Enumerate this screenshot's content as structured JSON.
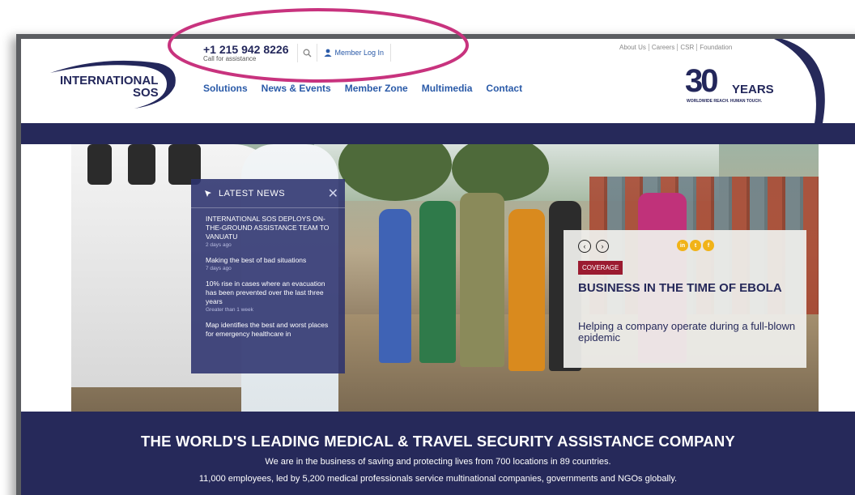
{
  "header": {
    "logo_line1": "INTERNATIONAL",
    "logo_line2": "SOS",
    "phone": "+1 215 942 8226",
    "phone_sub": "Call for assistance",
    "search_icon": "search-icon",
    "login_label": "Member Log In",
    "login_icon": "user-icon",
    "utility_links": [
      "About Us",
      "Careers",
      "CSR",
      "Foundation"
    ],
    "nav": [
      "Solutions",
      "News & Events",
      "Member Zone",
      "Multimedia",
      "Contact"
    ],
    "anniversary_number": "30",
    "anniversary_word": "YEARS",
    "anniversary_tagline": "WORLDWIDE REACH. HUMAN TOUCH."
  },
  "latest_news": {
    "title": "LATEST NEWS",
    "items": [
      {
        "headline": "INTERNATIONAL SOS DEPLOYS ON-THE-GROUND ASSISTANCE TEAM TO VANUATU",
        "date": "2 days ago"
      },
      {
        "headline": "Making the best of bad situations",
        "date": "7 days ago"
      },
      {
        "headline": "10% rise in cases where an evacuation has been prevented over the last three years",
        "date": "Greater than 1 week"
      },
      {
        "headline": "Map identifies the best and worst places for emergency healthcare in",
        "date": ""
      }
    ]
  },
  "feature": {
    "tag": "COVERAGE",
    "title": "BUSINESS IN THE TIME OF EBOLA",
    "subtitle": "Helping a company operate during a full-blown epidemic",
    "social": [
      "in",
      "t",
      "f"
    ]
  },
  "band": {
    "title": "THE WORLD'S LEADING MEDICAL & TRAVEL SECURITY ASSISTANCE COMPANY",
    "line1": "We are in the business of saving and protecting lives from 700 locations in 89 countries.",
    "line2": "11,000 employees, led by 5,200 medical professionals service multinational companies, governments and NGOs globally."
  },
  "colors": {
    "navy": "#26295a",
    "link_blue": "#2a5aa8",
    "tag_red": "#9b1b30",
    "social_gold": "#f1b318",
    "annotation": "#c8337e"
  }
}
